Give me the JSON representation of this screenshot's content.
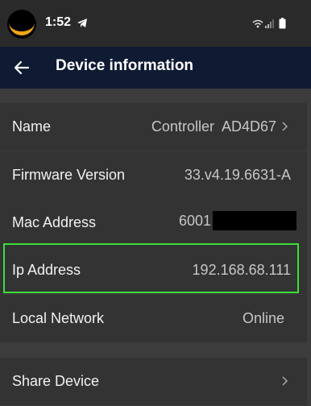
{
  "status_bar": {
    "time": "1:52",
    "icons": [
      "avatar",
      "telegram-icon",
      "wifi-icon",
      "signal-icon",
      "battery-icon"
    ]
  },
  "app_bar": {
    "back_icon": "back-arrow-icon",
    "title": "Device information"
  },
  "rows": {
    "name": {
      "label": "Name",
      "value": "Controller  AD4D67"
    },
    "firmware": {
      "label": "Firmware Version",
      "value": "33.v4.19.6631-A"
    },
    "mac": {
      "label": "Mac Address",
      "value": "6001"
    },
    "ip": {
      "label": "Ip Address",
      "value": "192.168.68.111"
    },
    "network": {
      "label": "Local Network",
      "value": "Online"
    },
    "share": {
      "label": "Share Device"
    }
  },
  "colors": {
    "background": "#3c3c3c",
    "row_background": "#333333",
    "app_bar": "#0f1b33",
    "highlight": "#3dde3a"
  }
}
